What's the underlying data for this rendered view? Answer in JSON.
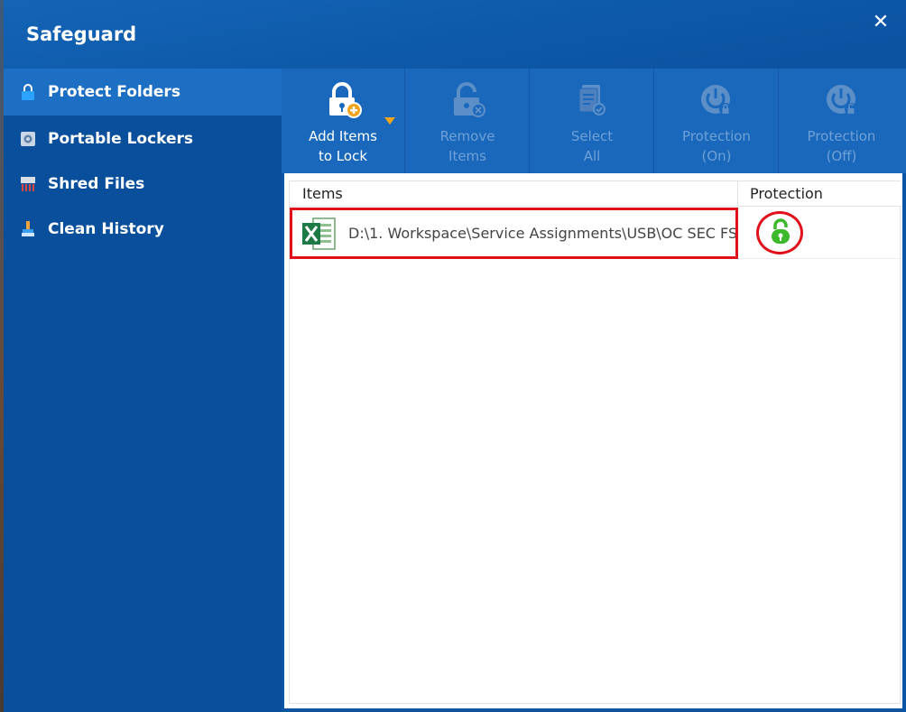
{
  "window": {
    "title": "Safeguard",
    "close_label": "✕"
  },
  "sidebar": {
    "items": [
      {
        "label": "Protect Folders",
        "icon": "lock-icon",
        "active": true
      },
      {
        "label": "Portable Lockers",
        "icon": "disk-icon",
        "active": false
      },
      {
        "label": "Shred Files",
        "icon": "shredder-icon",
        "active": false
      },
      {
        "label": "Clean History",
        "icon": "brush-icon",
        "active": false
      }
    ]
  },
  "toolbar": {
    "buttons": [
      {
        "line1": "Add Items",
        "line2": "to Lock",
        "icon": "lock-add-icon",
        "enabled": true
      },
      {
        "line1": "Remove",
        "line2": "Items",
        "icon": "lock-remove-icon",
        "enabled": false
      },
      {
        "line1": "Select",
        "line2": "All",
        "icon": "select-all-icon",
        "enabled": false
      },
      {
        "line1": "Protection",
        "line2": "(On)",
        "icon": "power-lock-icon",
        "enabled": false
      },
      {
        "line1": "Protection",
        "line2": "(Off)",
        "icon": "power-unlock-icon",
        "enabled": false
      }
    ]
  },
  "table": {
    "columns": [
      "Items",
      "Protection"
    ],
    "rows": [
      {
        "path": "D:\\1. Workspace\\Service Assignments\\USB\\OC SEC FS...",
        "file_icon": "excel-icon",
        "protection_icon": "green-lock-icon"
      }
    ]
  },
  "colors": {
    "accent": "#1a68bb",
    "sidebar": "#0a4f9c",
    "highlight": "#e0111b",
    "lock_green": "#3cb82b"
  }
}
